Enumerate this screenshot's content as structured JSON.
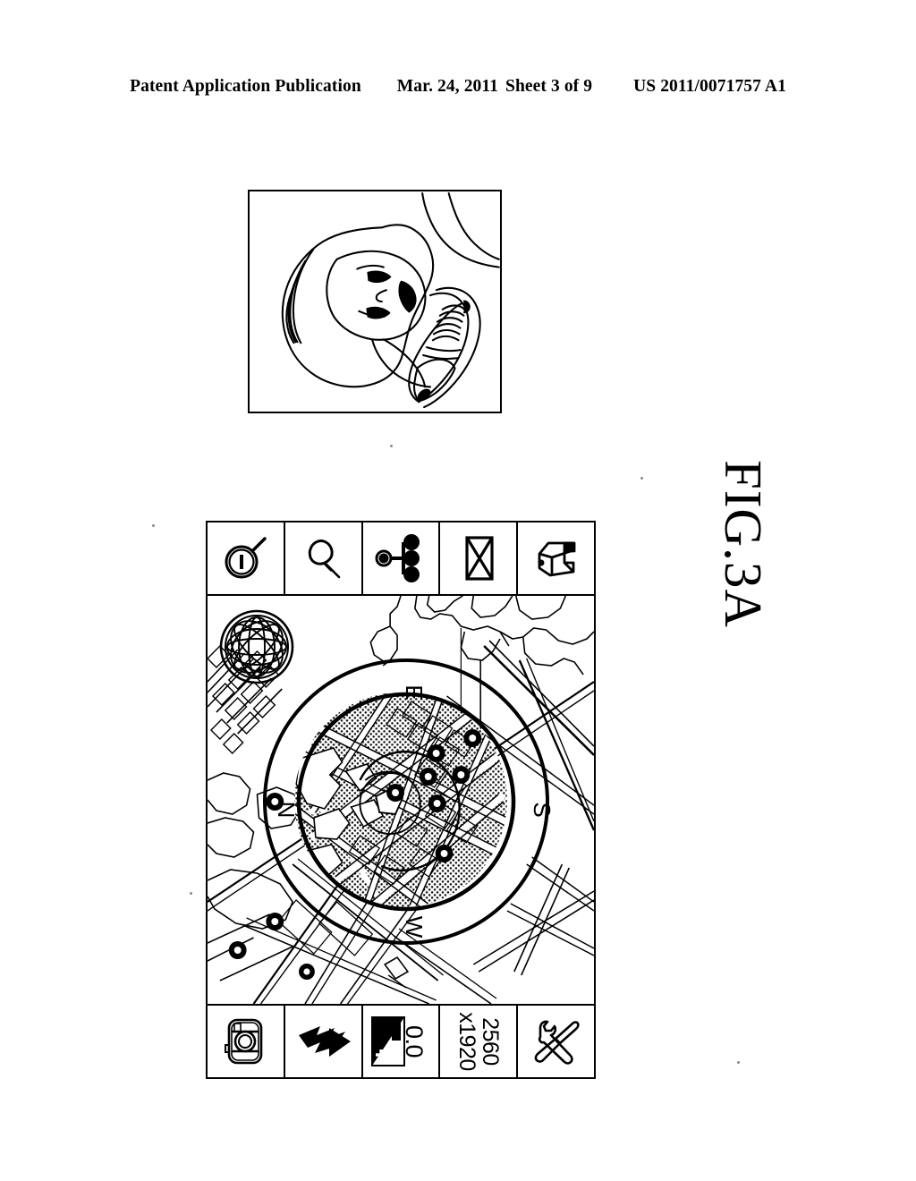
{
  "header": {
    "publication": "Patent Application Publication",
    "date": "Mar. 24, 2011",
    "sheet": "Sheet 3 of 9",
    "patent_number": "US 2011/0071757 A1"
  },
  "figure": {
    "label": "FIG.3A"
  },
  "photo_panel": {
    "name": "person-using-phone-illustration",
    "description": "Line drawing of a person's face with a flip mobile phone held to the ear"
  },
  "device": {
    "top_toolbar": {
      "items": [
        {
          "id": "search",
          "icon": "magnifier-icon",
          "label": ""
        },
        {
          "id": "pin",
          "icon": "map-pin-icon",
          "label": ""
        },
        {
          "id": "share",
          "icon": "share-network-icon",
          "label": ""
        },
        {
          "id": "mail",
          "icon": "envelope-icon",
          "label": ""
        },
        {
          "id": "package",
          "icon": "box-package-icon",
          "label": ""
        }
      ]
    },
    "bottom_toolbar": {
      "items": [
        {
          "id": "camera",
          "icon": "camera-icon",
          "label": ""
        },
        {
          "id": "flash",
          "icon": "flash-bolt-icon",
          "label": ""
        },
        {
          "id": "exposure",
          "icon": "exposure-compensation-icon",
          "label": "0.0"
        },
        {
          "id": "resolution",
          "icon": "",
          "label_line1": "2560",
          "label_line2": "x1920"
        },
        {
          "id": "tools",
          "icon": "wrench-screwdriver-icon",
          "label": ""
        }
      ]
    },
    "map": {
      "globe_badge_icon": "globe-wireframe-icon",
      "compass": {
        "directions": {
          "north": "N",
          "east": "E",
          "south": "S",
          "west": "W"
        }
      }
    }
  },
  "colors": {
    "ink": "#000000",
    "paper": "#ffffff",
    "stipple": "#1a1a1a"
  }
}
